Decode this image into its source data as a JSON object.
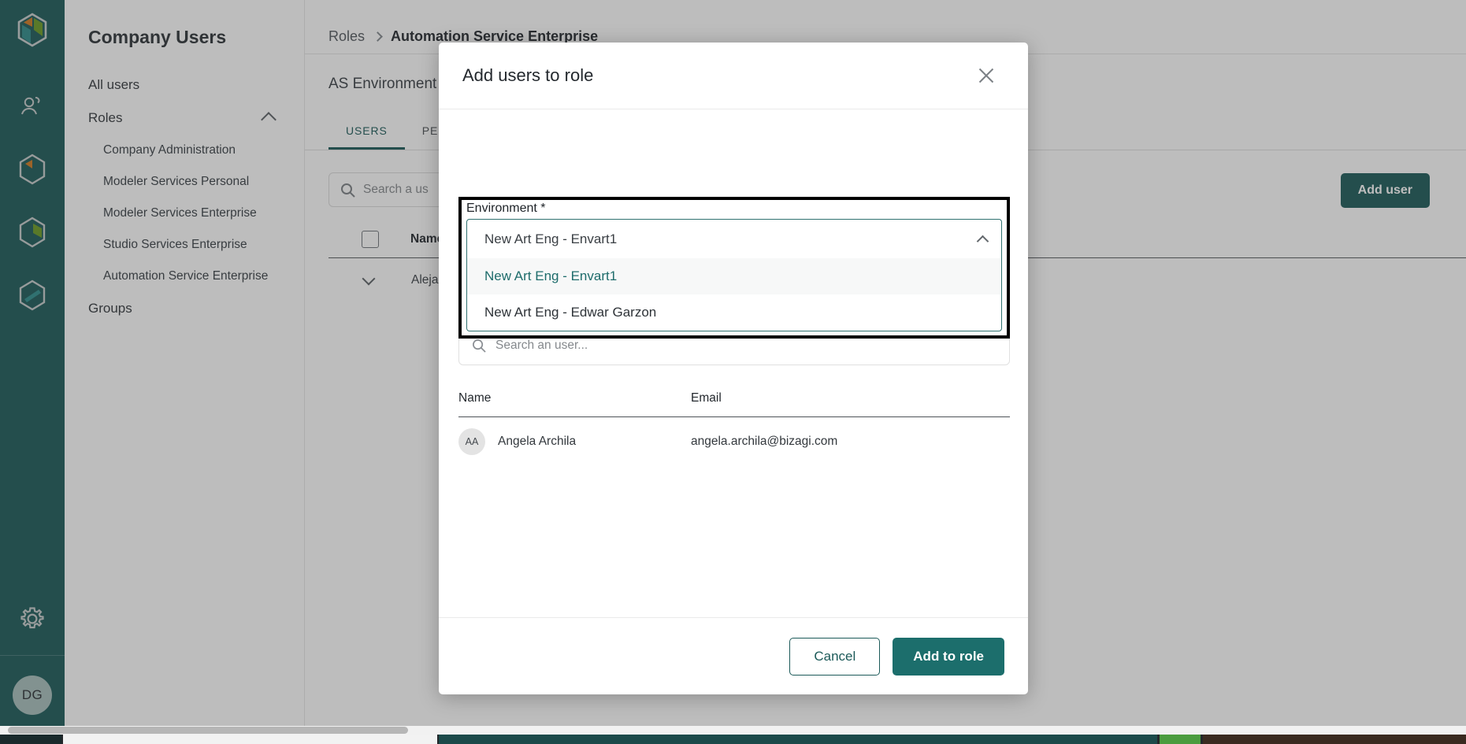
{
  "rail": {
    "logo_icon": "bizagi-hex-logo-icon",
    "items": [
      {
        "icon": "users-people-icon",
        "name": "people"
      },
      {
        "icon": "hex-orange-wedge-icon",
        "name": "modeler"
      },
      {
        "icon": "hex-green-wedge-icon",
        "name": "studio"
      },
      {
        "icon": "hex-teal-band-icon",
        "name": "automation"
      }
    ],
    "gear_icon": "gear-settings-icon",
    "avatar_initials": "DG"
  },
  "nav": {
    "title": "Company Users",
    "all_users": "All users",
    "roles_label": "Roles",
    "roles_chevron": "chevron-up-icon",
    "roles": [
      "Company Administration",
      "Modeler Services Personal",
      "Modeler Services Enterprise",
      "Studio Services Enterprise",
      "Automation Service Enterprise"
    ],
    "groups_label": "Groups"
  },
  "breadcrumb": {
    "parent": "Roles",
    "separator_icon": "chevron-right-icon",
    "current": "Automation Service Enterprise"
  },
  "page": {
    "heading": "AS Environment T",
    "tabs": [
      {
        "label": "USERS",
        "active": true
      },
      {
        "label": "PER",
        "active": false
      }
    ],
    "search_placeholder": "Search a us",
    "search_icon": "search-icon",
    "add_user_button": "Add user",
    "table": {
      "select_all_icon": "checkbox-unchecked-icon",
      "columns": [
        "Name"
      ],
      "rows": [
        {
          "expand_icon": "chevron-down-icon",
          "name": "Alejan"
        }
      ]
    }
  },
  "modal": {
    "title": "Add users to role",
    "close_icon": "close-icon",
    "environment": {
      "label": "Environment *",
      "selected": "New Art Eng - Envart1",
      "caret_icon": "chevron-up-icon",
      "options": [
        {
          "label": "New Art Eng - Envart1",
          "selected": true
        },
        {
          "label": "New Art Eng - Edwar Garzon",
          "selected": false
        }
      ]
    },
    "user_search": {
      "icon": "search-icon",
      "placeholder": "Search an user..."
    },
    "table": {
      "columns": [
        "Name",
        "Email"
      ],
      "rows": [
        {
          "initials": "AA",
          "name": "Angela Archila",
          "email": "angela.archila@bizagi.com"
        }
      ]
    },
    "cancel_label": "Cancel",
    "submit_label": "Add to role"
  },
  "colors": {
    "brand_teal": "#1c5a59",
    "primary_button": "#1c6e6c",
    "option_selected_text": "#1e6c6b",
    "focus_outline": "#000000"
  }
}
